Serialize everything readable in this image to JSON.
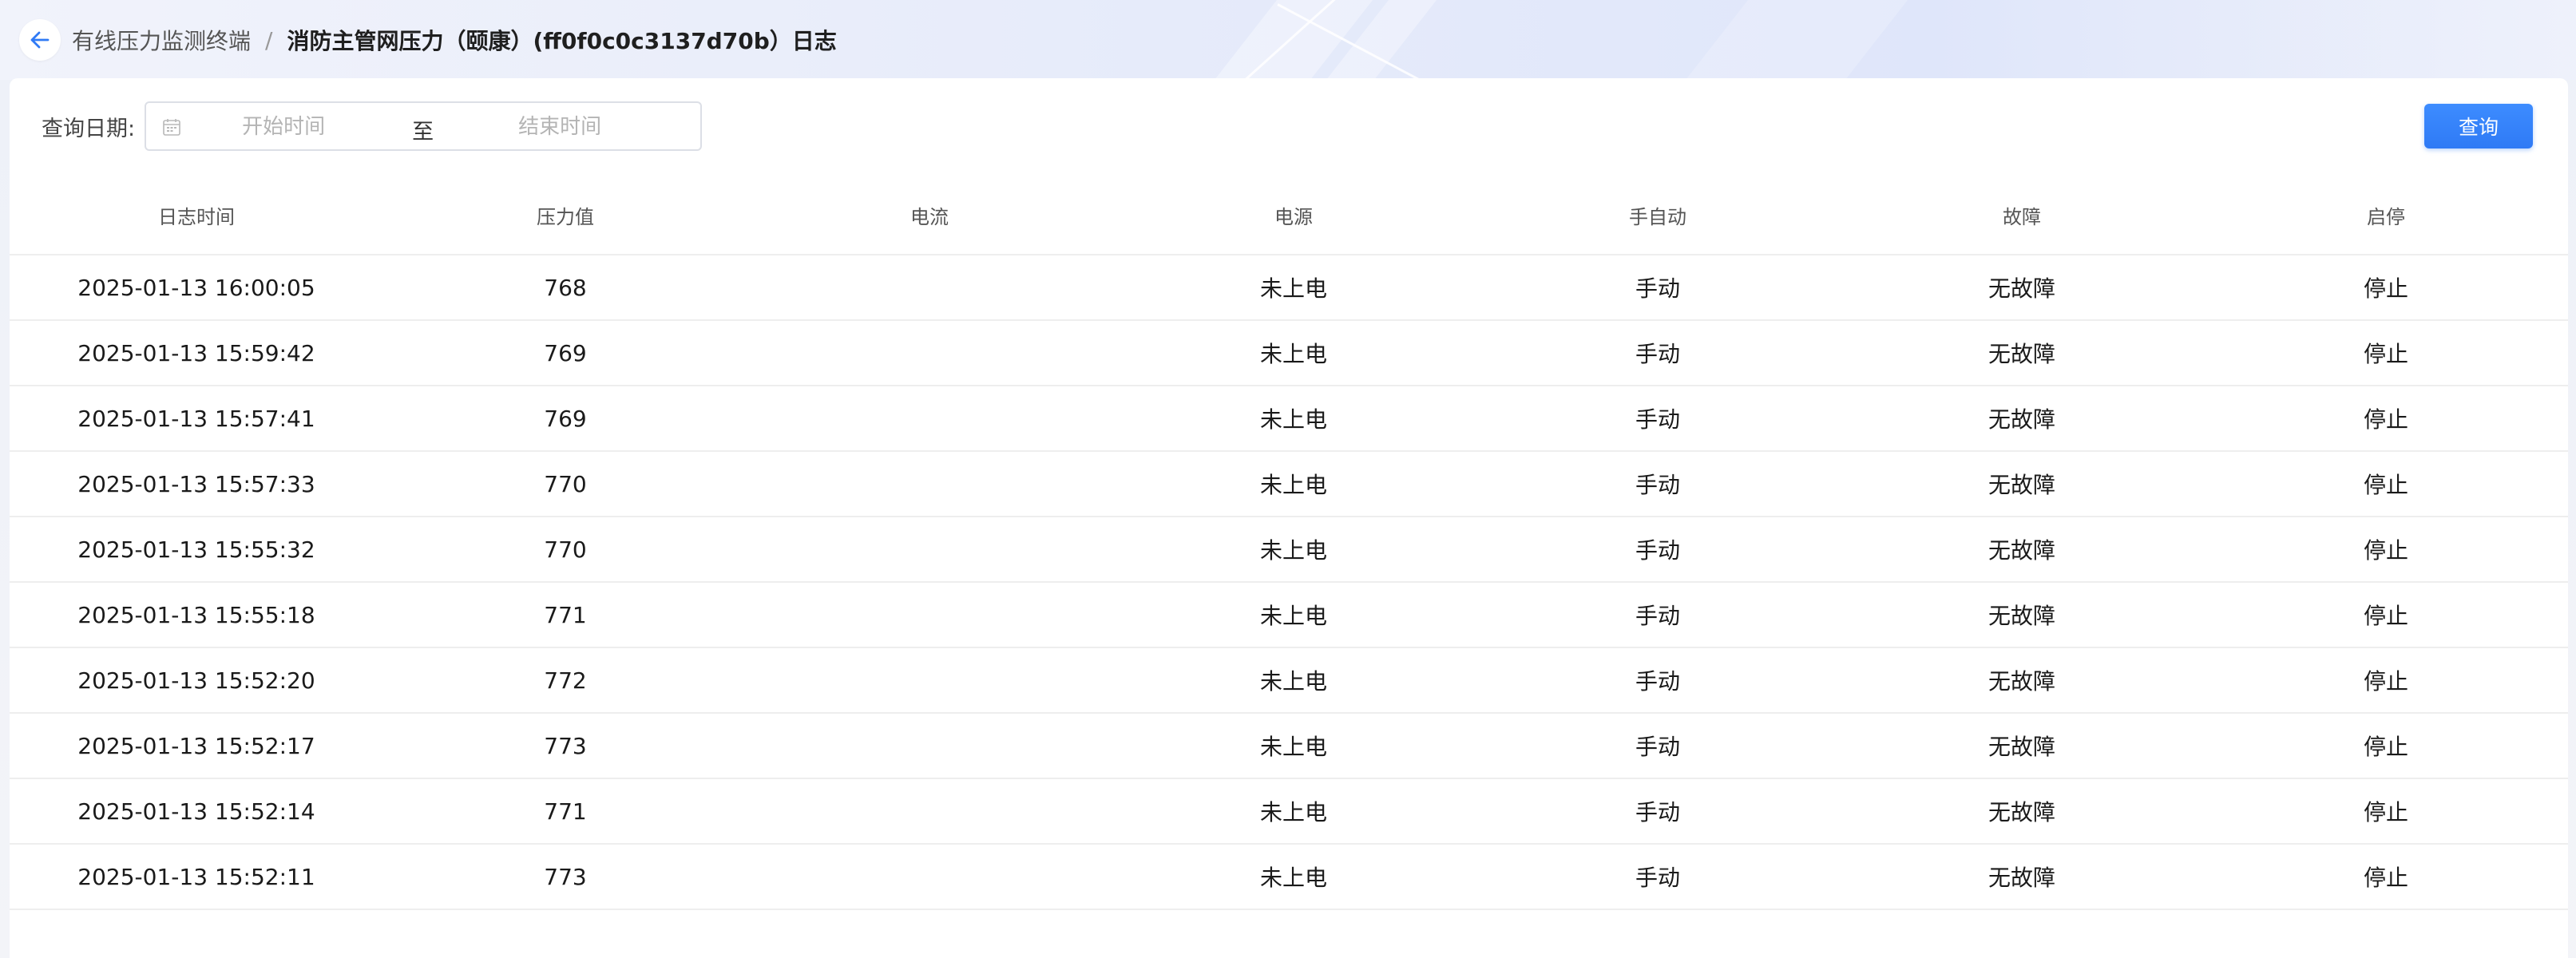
{
  "header": {
    "back_icon": "arrow-left-icon",
    "crumb_parent": "有线压力监测终端",
    "crumb_separator": "/",
    "crumb_current": "消防主管网压力（颐康）(ff0f0c0c3137d70b）日志"
  },
  "filter": {
    "label": "查询日期:",
    "calendar_icon": "calendar-icon",
    "start_placeholder": "开始时间",
    "separator": "至",
    "end_placeholder": "结束时间",
    "query_label": "查询"
  },
  "colors": {
    "accent": "#2f7af5",
    "border": "#dcdfe6"
  },
  "table": {
    "columns": [
      "日志时间",
      "压力值",
      "电流",
      "电源",
      "手自动",
      "故障",
      "启停"
    ],
    "rows": [
      [
        "2025-01-13 16:00:05",
        "768",
        "",
        "未上电",
        "手动",
        "无故障",
        "停止"
      ],
      [
        "2025-01-13 15:59:42",
        "769",
        "",
        "未上电",
        "手动",
        "无故障",
        "停止"
      ],
      [
        "2025-01-13 15:57:41",
        "769",
        "",
        "未上电",
        "手动",
        "无故障",
        "停止"
      ],
      [
        "2025-01-13 15:57:33",
        "770",
        "",
        "未上电",
        "手动",
        "无故障",
        "停止"
      ],
      [
        "2025-01-13 15:55:32",
        "770",
        "",
        "未上电",
        "手动",
        "无故障",
        "停止"
      ],
      [
        "2025-01-13 15:55:18",
        "771",
        "",
        "未上电",
        "手动",
        "无故障",
        "停止"
      ],
      [
        "2025-01-13 15:52:20",
        "772",
        "",
        "未上电",
        "手动",
        "无故障",
        "停止"
      ],
      [
        "2025-01-13 15:52:17",
        "773",
        "",
        "未上电",
        "手动",
        "无故障",
        "停止"
      ],
      [
        "2025-01-13 15:52:14",
        "771",
        "",
        "未上电",
        "手动",
        "无故障",
        "停止"
      ],
      [
        "2025-01-13 15:52:11",
        "773",
        "",
        "未上电",
        "手动",
        "无故障",
        "停止"
      ]
    ]
  }
}
